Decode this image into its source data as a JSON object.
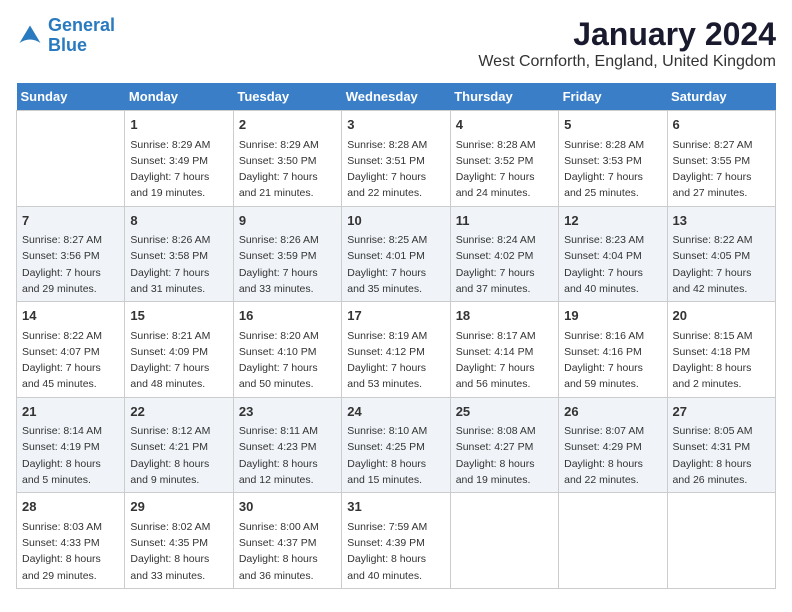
{
  "logo": {
    "line1": "General",
    "line2": "Blue"
  },
  "title": "January 2024",
  "location": "West Cornforth, England, United Kingdom",
  "days_of_week": [
    "Sunday",
    "Monday",
    "Tuesday",
    "Wednesday",
    "Thursday",
    "Friday",
    "Saturday"
  ],
  "weeks": [
    [
      {
        "day": "",
        "info": ""
      },
      {
        "day": "1",
        "info": "Sunrise: 8:29 AM\nSunset: 3:49 PM\nDaylight: 7 hours\nand 19 minutes."
      },
      {
        "day": "2",
        "info": "Sunrise: 8:29 AM\nSunset: 3:50 PM\nDaylight: 7 hours\nand 21 minutes."
      },
      {
        "day": "3",
        "info": "Sunrise: 8:28 AM\nSunset: 3:51 PM\nDaylight: 7 hours\nand 22 minutes."
      },
      {
        "day": "4",
        "info": "Sunrise: 8:28 AM\nSunset: 3:52 PM\nDaylight: 7 hours\nand 24 minutes."
      },
      {
        "day": "5",
        "info": "Sunrise: 8:28 AM\nSunset: 3:53 PM\nDaylight: 7 hours\nand 25 minutes."
      },
      {
        "day": "6",
        "info": "Sunrise: 8:27 AM\nSunset: 3:55 PM\nDaylight: 7 hours\nand 27 minutes."
      }
    ],
    [
      {
        "day": "7",
        "info": "Sunrise: 8:27 AM\nSunset: 3:56 PM\nDaylight: 7 hours\nand 29 minutes."
      },
      {
        "day": "8",
        "info": "Sunrise: 8:26 AM\nSunset: 3:58 PM\nDaylight: 7 hours\nand 31 minutes."
      },
      {
        "day": "9",
        "info": "Sunrise: 8:26 AM\nSunset: 3:59 PM\nDaylight: 7 hours\nand 33 minutes."
      },
      {
        "day": "10",
        "info": "Sunrise: 8:25 AM\nSunset: 4:01 PM\nDaylight: 7 hours\nand 35 minutes."
      },
      {
        "day": "11",
        "info": "Sunrise: 8:24 AM\nSunset: 4:02 PM\nDaylight: 7 hours\nand 37 minutes."
      },
      {
        "day": "12",
        "info": "Sunrise: 8:23 AM\nSunset: 4:04 PM\nDaylight: 7 hours\nand 40 minutes."
      },
      {
        "day": "13",
        "info": "Sunrise: 8:22 AM\nSunset: 4:05 PM\nDaylight: 7 hours\nand 42 minutes."
      }
    ],
    [
      {
        "day": "14",
        "info": "Sunrise: 8:22 AM\nSunset: 4:07 PM\nDaylight: 7 hours\nand 45 minutes."
      },
      {
        "day": "15",
        "info": "Sunrise: 8:21 AM\nSunset: 4:09 PM\nDaylight: 7 hours\nand 48 minutes."
      },
      {
        "day": "16",
        "info": "Sunrise: 8:20 AM\nSunset: 4:10 PM\nDaylight: 7 hours\nand 50 minutes."
      },
      {
        "day": "17",
        "info": "Sunrise: 8:19 AM\nSunset: 4:12 PM\nDaylight: 7 hours\nand 53 minutes."
      },
      {
        "day": "18",
        "info": "Sunrise: 8:17 AM\nSunset: 4:14 PM\nDaylight: 7 hours\nand 56 minutes."
      },
      {
        "day": "19",
        "info": "Sunrise: 8:16 AM\nSunset: 4:16 PM\nDaylight: 7 hours\nand 59 minutes."
      },
      {
        "day": "20",
        "info": "Sunrise: 8:15 AM\nSunset: 4:18 PM\nDaylight: 8 hours\nand 2 minutes."
      }
    ],
    [
      {
        "day": "21",
        "info": "Sunrise: 8:14 AM\nSunset: 4:19 PM\nDaylight: 8 hours\nand 5 minutes."
      },
      {
        "day": "22",
        "info": "Sunrise: 8:12 AM\nSunset: 4:21 PM\nDaylight: 8 hours\nand 9 minutes."
      },
      {
        "day": "23",
        "info": "Sunrise: 8:11 AM\nSunset: 4:23 PM\nDaylight: 8 hours\nand 12 minutes."
      },
      {
        "day": "24",
        "info": "Sunrise: 8:10 AM\nSunset: 4:25 PM\nDaylight: 8 hours\nand 15 minutes."
      },
      {
        "day": "25",
        "info": "Sunrise: 8:08 AM\nSunset: 4:27 PM\nDaylight: 8 hours\nand 19 minutes."
      },
      {
        "day": "26",
        "info": "Sunrise: 8:07 AM\nSunset: 4:29 PM\nDaylight: 8 hours\nand 22 minutes."
      },
      {
        "day": "27",
        "info": "Sunrise: 8:05 AM\nSunset: 4:31 PM\nDaylight: 8 hours\nand 26 minutes."
      }
    ],
    [
      {
        "day": "28",
        "info": "Sunrise: 8:03 AM\nSunset: 4:33 PM\nDaylight: 8 hours\nand 29 minutes."
      },
      {
        "day": "29",
        "info": "Sunrise: 8:02 AM\nSunset: 4:35 PM\nDaylight: 8 hours\nand 33 minutes."
      },
      {
        "day": "30",
        "info": "Sunrise: 8:00 AM\nSunset: 4:37 PM\nDaylight: 8 hours\nand 36 minutes."
      },
      {
        "day": "31",
        "info": "Sunrise: 7:59 AM\nSunset: 4:39 PM\nDaylight: 8 hours\nand 40 minutes."
      },
      {
        "day": "",
        "info": ""
      },
      {
        "day": "",
        "info": ""
      },
      {
        "day": "",
        "info": ""
      }
    ]
  ]
}
